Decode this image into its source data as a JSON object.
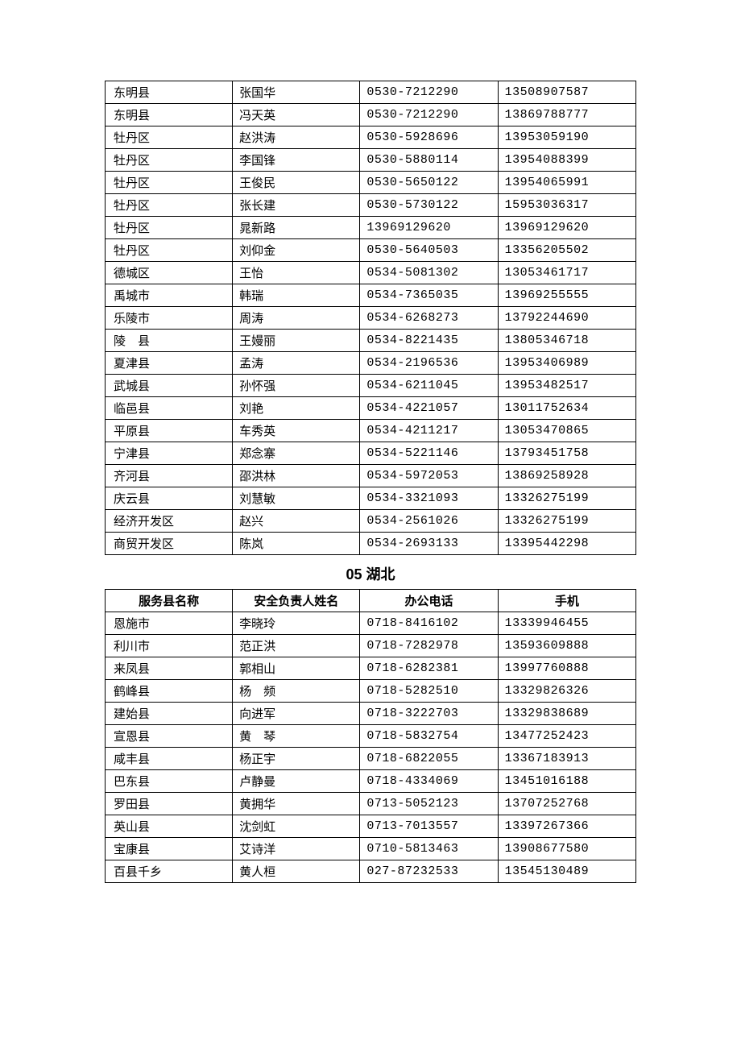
{
  "table1": {
    "rows": [
      {
        "county": "东明县",
        "name": "张国华",
        "office": "0530-7212290",
        "mobile": "13508907587"
      },
      {
        "county": "东明县",
        "name": "冯天英",
        "office": "0530-7212290",
        "mobile": "13869788777"
      },
      {
        "county": "牡丹区",
        "name": "赵洪涛",
        "office": "0530-5928696",
        "mobile": "13953059190"
      },
      {
        "county": "牡丹区",
        "name": "李国锋",
        "office": "0530-5880114",
        "mobile": "13954088399"
      },
      {
        "county": "牡丹区",
        "name": "王俊民",
        "office": "0530-5650122",
        "mobile": "13954065991"
      },
      {
        "county": "牡丹区",
        "name": "张长建",
        "office": "0530-5730122",
        "mobile": "15953036317"
      },
      {
        "county": "牡丹区",
        "name": "晁新路",
        "office": "13969129620",
        "mobile": "13969129620"
      },
      {
        "county": "牡丹区",
        "name": "刘仰金",
        "office": "0530-5640503",
        "mobile": "13356205502"
      },
      {
        "county": "德城区",
        "name": "王怡",
        "office": "0534-5081302",
        "mobile": "13053461717"
      },
      {
        "county": "禹城市",
        "name": "韩瑞",
        "office": "0534-7365035",
        "mobile": "13969255555"
      },
      {
        "county": "乐陵市",
        "name": "周涛",
        "office": "0534-6268273",
        "mobile": "13792244690"
      },
      {
        "county": "陵　县",
        "name": "王嫚丽",
        "office": "0534-8221435",
        "mobile": "13805346718"
      },
      {
        "county": "夏津县",
        "name": "孟涛",
        "office": "0534-2196536",
        "mobile": "13953406989"
      },
      {
        "county": "武城县",
        "name": "孙怀强",
        "office": "0534-6211045",
        "mobile": "13953482517"
      },
      {
        "county": "临邑县",
        "name": "刘艳",
        "office": "0534-4221057",
        "mobile": "13011752634"
      },
      {
        "county": "平原县",
        "name": "车秀英",
        "office": "0534-4211217",
        "mobile": "13053470865"
      },
      {
        "county": "宁津县",
        "name": "郑念寨",
        "office": "0534-5221146",
        "mobile": "13793451758"
      },
      {
        "county": "齐河县",
        "name": "邵洪林",
        "office": "0534-5972053",
        "mobile": "13869258928"
      },
      {
        "county": "庆云县",
        "name": "刘慧敏",
        "office": "0534-3321093",
        "mobile": "13326275199"
      },
      {
        "county": "经济开发区",
        "name": "赵兴",
        "office": "0534-2561026",
        "mobile": "13326275199"
      },
      {
        "county": "商贸开发区",
        "name": "陈岚",
        "office": "0534-2693133",
        "mobile": "13395442298"
      }
    ]
  },
  "section2": {
    "title": "05 湖北",
    "headers": {
      "county": "服务县名称",
      "name": "安全负责人姓名",
      "office": "办公电话",
      "mobile": "手机"
    },
    "rows": [
      {
        "county": "恩施市",
        "name": "李晓玲",
        "office": "0718-8416102",
        "mobile": "13339946455"
      },
      {
        "county": "利川市",
        "name": "范正洪",
        "office": "0718-7282978",
        "mobile": "13593609888"
      },
      {
        "county": "来凤县",
        "name": "郭相山",
        "office": "0718-6282381",
        "mobile": "13997760888"
      },
      {
        "county": "鹤峰县",
        "name": "杨　频",
        "office": "0718-5282510",
        "mobile": "13329826326"
      },
      {
        "county": "建始县",
        "name": "向进军",
        "office": "0718-3222703",
        "mobile": "13329838689"
      },
      {
        "county": "宣恩县",
        "name": "黄　琴",
        "office": "0718-5832754",
        "mobile": "13477252423"
      },
      {
        "county": "咸丰县",
        "name": "杨正宇",
        "office": "0718-6822055",
        "mobile": "13367183913"
      },
      {
        "county": "巴东县",
        "name": "卢静曼",
        "office": "0718-4334069",
        "mobile": "13451016188"
      },
      {
        "county": "罗田县",
        "name": "黄拥华",
        "office": "0713-5052123",
        "mobile": "13707252768"
      },
      {
        "county": "英山县",
        "name": "沈剑虹",
        "office": "0713-7013557",
        "mobile": "13397267366"
      },
      {
        "county": "宝康县",
        "name": "艾诗洋",
        "office": "0710-5813463",
        "mobile": "13908677580"
      },
      {
        "county": "百县千乡",
        "name": "黄人桓",
        "office": "027-87232533",
        "mobile": "13545130489"
      }
    ]
  }
}
